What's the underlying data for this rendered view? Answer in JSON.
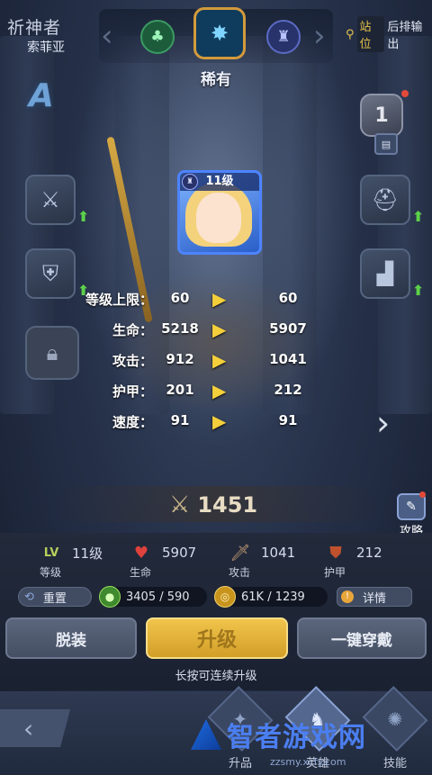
{
  "hero": {
    "title": "祈神者",
    "name": "索菲亚",
    "grade": "A",
    "rarity": "稀有",
    "level_label": "11级",
    "rank_number": "1"
  },
  "position": {
    "tag": "站位",
    "value": "后排输出"
  },
  "stats_rows": [
    {
      "label": "等级上限：",
      "current": "60",
      "next": "60"
    },
    {
      "label": "生命：",
      "current": "5218",
      "next": "5907"
    },
    {
      "label": "攻击：",
      "current": "912",
      "next": "1041"
    },
    {
      "label": "护甲：",
      "current": "201",
      "next": "212"
    },
    {
      "label": "速度：",
      "current": "91",
      "next": "91"
    }
  ],
  "power": "1451",
  "guide_label": "攻略",
  "summary": {
    "level": {
      "icon": "LV",
      "value": "11级",
      "label": "等级"
    },
    "hp": {
      "value": "5907",
      "label": "生命"
    },
    "attack": {
      "value": "1041",
      "label": "攻击"
    },
    "armor": {
      "value": "212",
      "label": "护甲"
    }
  },
  "resources": {
    "reset_label": "重置",
    "exp": "3405 / 590",
    "gold": "61K / 1239",
    "detail_label": "详情"
  },
  "buttons": {
    "unequip": "脱装",
    "upgrade": "升级",
    "equip_all": "一键穿戴",
    "hold_tip": "长按可连续升级"
  },
  "nav": {
    "tabs": [
      "升品",
      "英雄",
      "技能"
    ]
  },
  "watermark": {
    "text": "智者游戏网",
    "url": "zzsmy.xcfy.com"
  },
  "colors": {
    "accent_gold": "#f1c44c",
    "stat_arrow": "#f4cf3b",
    "upgrade_arrow": "#5cd04a",
    "badge_red": "#e34a3a"
  }
}
